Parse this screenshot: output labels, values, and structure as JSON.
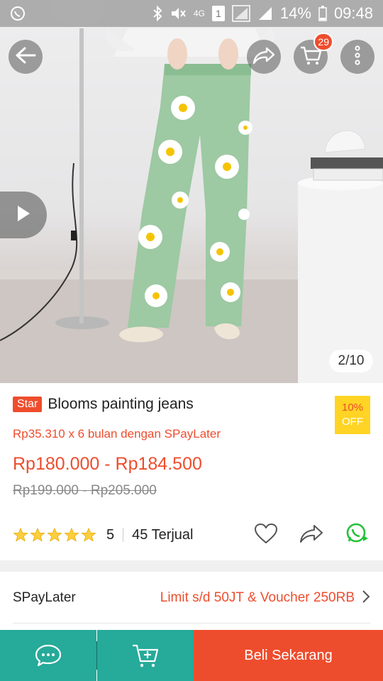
{
  "statusbar": {
    "network_label": "4G",
    "sim_label": "1",
    "battery": "14%",
    "time": "09:48"
  },
  "gallery": {
    "page_indicator": "2/10",
    "cart_count": "29"
  },
  "product": {
    "badge": "Star",
    "title": "Blooms painting jeans",
    "discount_percent": "10%",
    "discount_label": "OFF",
    "spaylater_installment": "Rp35.310 x 6 bulan dengan SPayLater",
    "price_range": "Rp180.000 - Rp184.500",
    "original_price_range": "Rp199.000 - Rp205.000",
    "rating_stars": 5,
    "rating_value": "5",
    "sold": "45 Terjual"
  },
  "spaylater": {
    "label": "SPayLater",
    "value": "Limit s/d 50JT & Voucher 250RB"
  },
  "bottom_bar": {
    "buy_label": "Beli Sekarang"
  },
  "colors": {
    "brand_orange": "#ee4d2d",
    "teal": "#26aa99",
    "star_yellow": "#ffce3d",
    "whatsapp_green": "#25c03a"
  }
}
